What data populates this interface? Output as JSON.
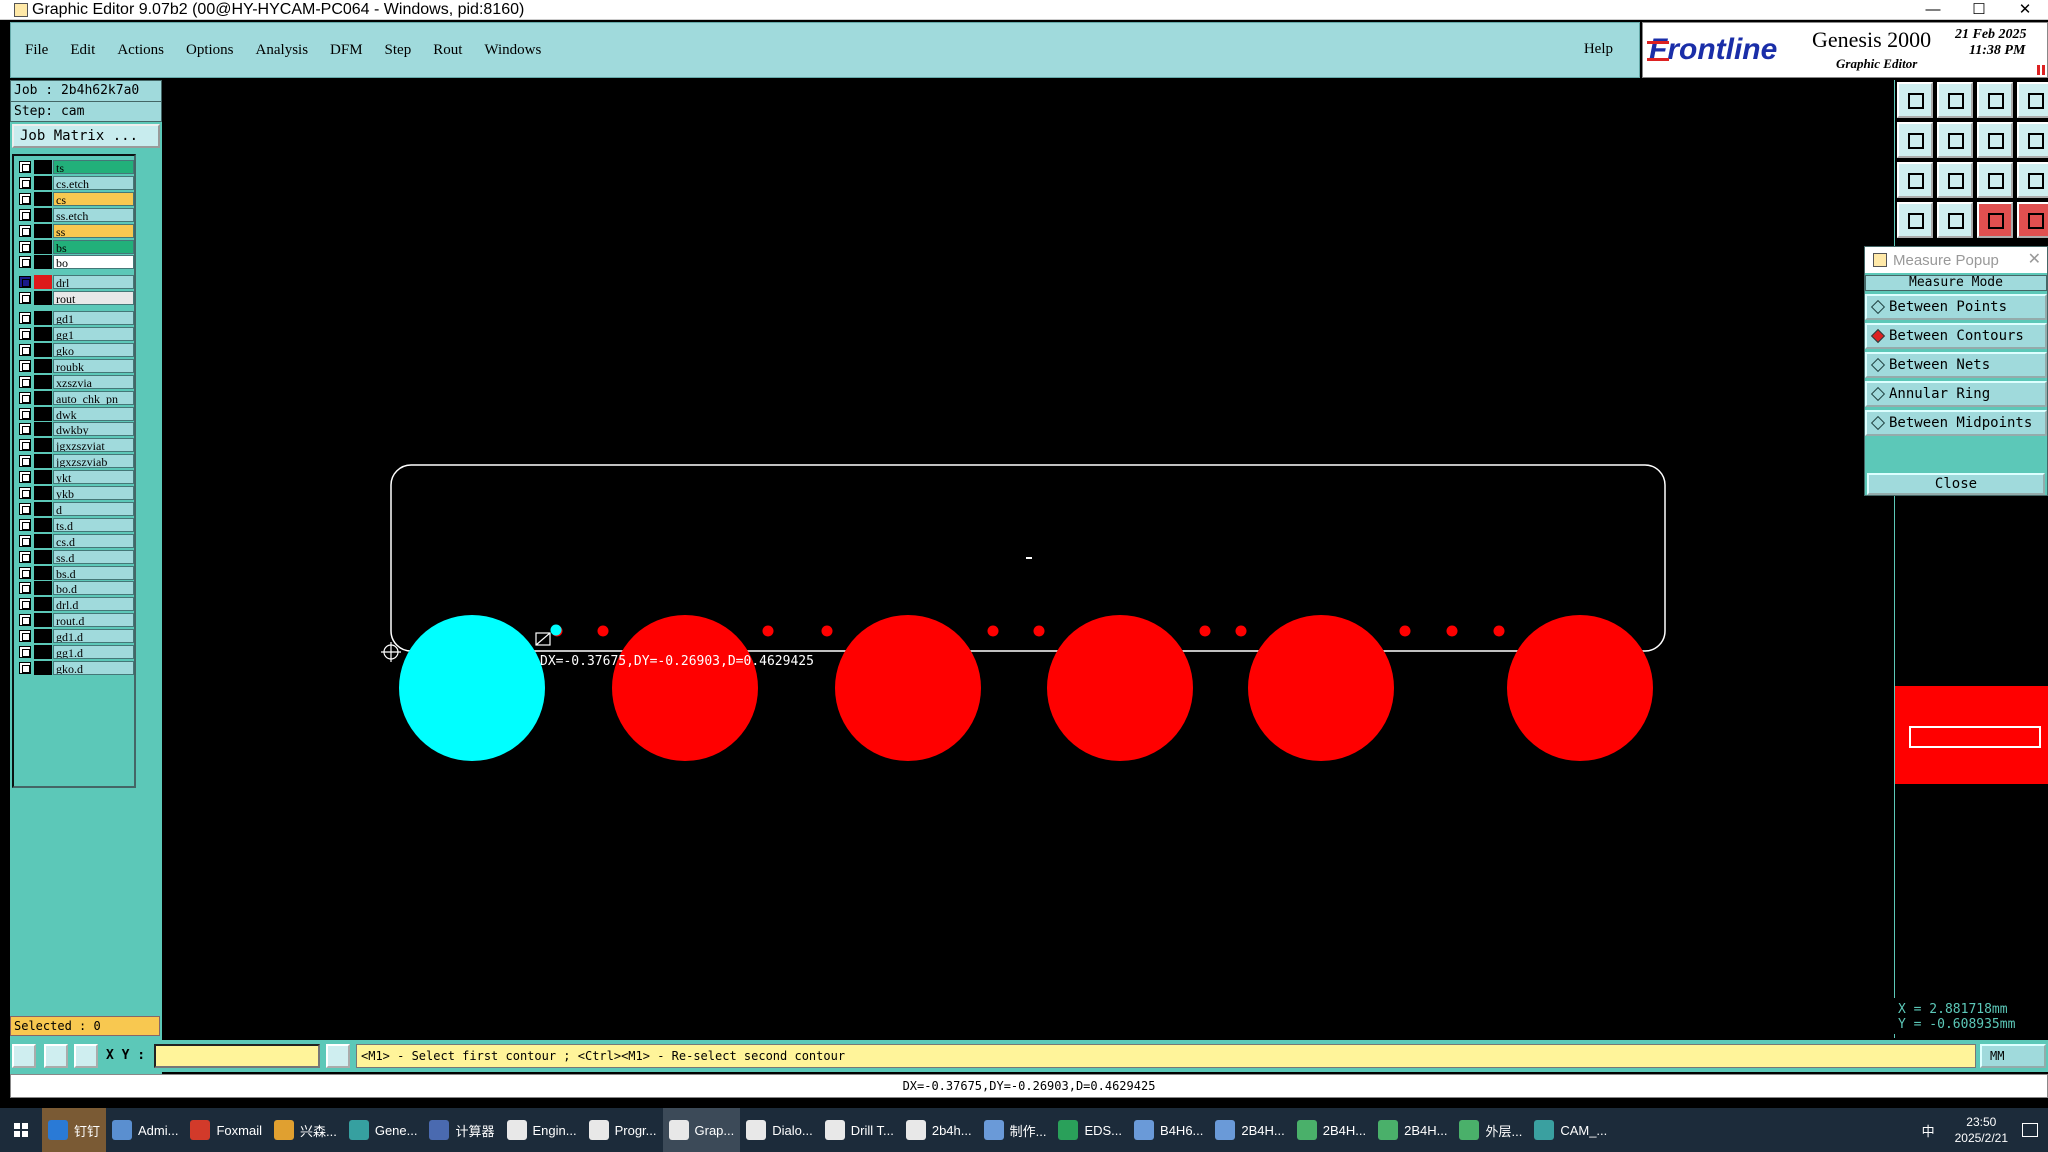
{
  "window": {
    "title": "Graphic Editor 9.07b2 (00@HY-HYCAM-PC064 - Windows, pid:8160)",
    "controls": [
      "—",
      "☐",
      "✕"
    ]
  },
  "menu": {
    "items": [
      "File",
      "Edit",
      "Actions",
      "Options",
      "Analysis",
      "DFM",
      "Step",
      "Rout",
      "Windows"
    ],
    "help": "Help"
  },
  "brand": {
    "logo": "Frontline",
    "product": "Genesis 2000",
    "subtitle": "Graphic Editor",
    "date": "21 Feb 2025",
    "time": "11:38 PM"
  },
  "job": {
    "job_line": "Job : 2b4h62k7a0",
    "step_line": "Step: cam",
    "matrix_button": "Job Matrix ..."
  },
  "layers": [
    {
      "name": "ts",
      "color": "#22b07a"
    },
    {
      "name": "cs.etch",
      "color": "#a0dadc"
    },
    {
      "name": "cs",
      "color": "#f8c850"
    },
    {
      "name": "ss.etch",
      "color": "#a0dadc"
    },
    {
      "name": "ss",
      "color": "#f8c850"
    },
    {
      "name": "bs",
      "color": "#22b07a"
    },
    {
      "name": "bo",
      "color": "#ffffff"
    },
    {
      "name": "drl",
      "color": "#a0dadc",
      "swatch": "#dd1a1a",
      "checked": true
    },
    {
      "name": "rout",
      "color": "#e8e8e8"
    },
    {
      "name": "gd1",
      "color": "#a0dadc"
    },
    {
      "name": "gg1",
      "color": "#a0dadc"
    },
    {
      "name": "gko",
      "color": "#a0dadc"
    },
    {
      "name": "roubk",
      "color": "#a0dadc"
    },
    {
      "name": "xzszvia",
      "color": "#a0dadc"
    },
    {
      "name": "auto_chk_pn",
      "color": "#a0dadc"
    },
    {
      "name": "dwk",
      "color": "#a0dadc"
    },
    {
      "name": "dwkby",
      "color": "#a0dadc"
    },
    {
      "name": "jgxzszviat",
      "color": "#a0dadc"
    },
    {
      "name": "jgxzszviab",
      "color": "#a0dadc"
    },
    {
      "name": "ykt",
      "color": "#a0dadc"
    },
    {
      "name": "ykb",
      "color": "#a0dadc"
    },
    {
      "name": "d",
      "color": "#a0dadc"
    },
    {
      "name": "ts.d",
      "color": "#a0dadc"
    },
    {
      "name": "cs.d",
      "color": "#a0dadc"
    },
    {
      "name": "ss.d",
      "color": "#a0dadc"
    },
    {
      "name": "bs.d",
      "color": "#a0dadc"
    },
    {
      "name": "bo.d",
      "color": "#a0dadc"
    },
    {
      "name": "drl.d",
      "color": "#a0dadc"
    },
    {
      "name": "rout.d",
      "color": "#a0dadc"
    },
    {
      "name": "gd1.d",
      "color": "#a0dadc"
    },
    {
      "name": "gg1.d",
      "color": "#a0dadc"
    },
    {
      "name": "gko.d",
      "color": "#a0dadc"
    }
  ],
  "selected": "Selected : 0",
  "canvas": {
    "measure_readout": "DX=-0.37675,DY=-0.26903,D=0.4629425",
    "colors": {
      "background": "#000000",
      "hole": "#ff0000",
      "selected_hole": "#00ffff",
      "outline": "#ffffff"
    }
  },
  "measure_popup": {
    "title": "Measure Popup",
    "mode_label": "Measure Mode",
    "options": [
      "Between Points",
      "Between Contours",
      "Between Nets",
      "Annular Ring",
      "Between Midpoints"
    ],
    "selected_option": "Between Contours",
    "close": "Close"
  },
  "coords": {
    "x": "X = 2.881718mm",
    "y": "Y = -0.608935mm"
  },
  "cmdbar": {
    "xy_label": "X Y :",
    "xy_value": "",
    "prompt": "<M1> - Select first contour ; <Ctrl><M1> - Re-select second contour",
    "unit": "MM"
  },
  "status": "DX=-0.37675,DY=-0.26903,D=0.4629425",
  "taskbar": {
    "items": [
      {
        "label": "钉钉",
        "style": "brown"
      },
      {
        "label": "Admi..."
      },
      {
        "label": "Foxmail"
      },
      {
        "label": "兴森..."
      },
      {
        "label": "Gene..."
      },
      {
        "label": "计算器"
      },
      {
        "label": "Engin..."
      },
      {
        "label": "Progr..."
      },
      {
        "label": "Grap...",
        "style": "active"
      },
      {
        "label": "Dialo..."
      },
      {
        "label": "Drill T..."
      },
      {
        "label": "2b4h..."
      },
      {
        "label": "制作..."
      },
      {
        "label": "EDS..."
      },
      {
        "label": "B4H6..."
      },
      {
        "label": "2B4H..."
      },
      {
        "label": "2B4H..."
      },
      {
        "label": "2B4H..."
      },
      {
        "label": "外层..."
      },
      {
        "label": "CAM_..."
      }
    ],
    "tray_ime": "中",
    "clock_time": "23:50",
    "clock_date": "2025/2/21"
  }
}
